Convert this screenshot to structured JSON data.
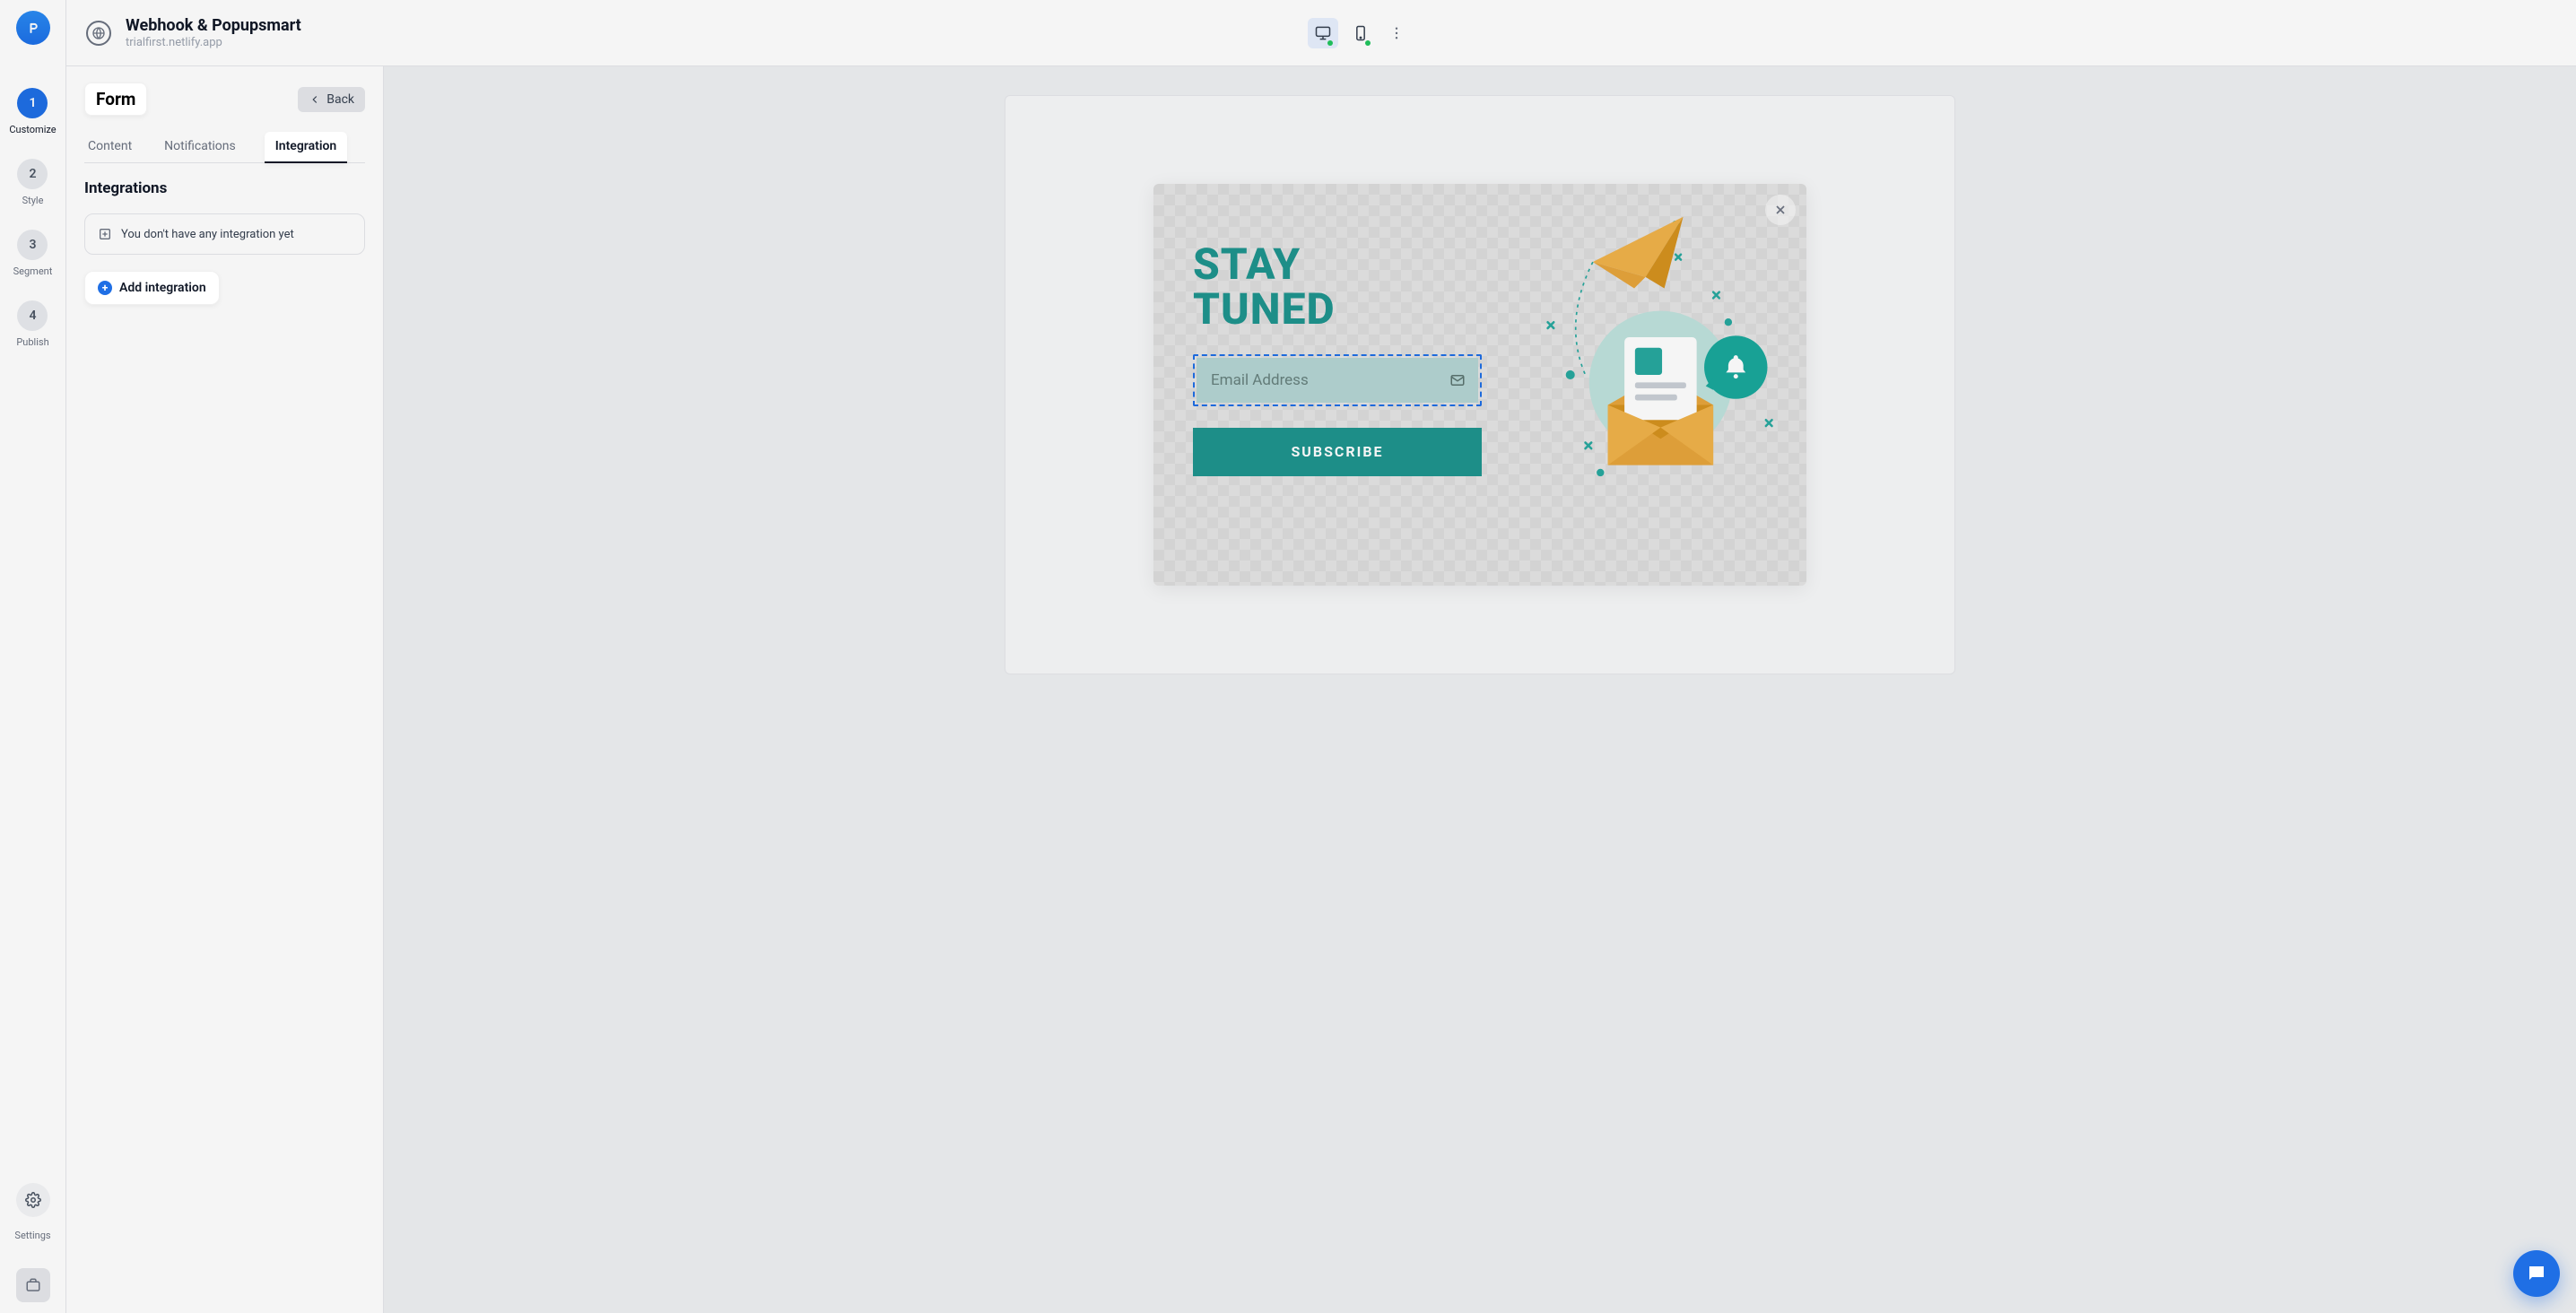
{
  "header": {
    "title": "Webhook & Popupsmart",
    "url": "trialfirst.netlify.app"
  },
  "devices": {
    "desktop_active": true,
    "mobile_active": false
  },
  "rail": {
    "steps": [
      {
        "num": "1",
        "label": "Customize",
        "active": true
      },
      {
        "num": "2",
        "label": "Style",
        "active": false
      },
      {
        "num": "3",
        "label": "Segment",
        "active": false
      },
      {
        "num": "4",
        "label": "Publish",
        "active": false
      }
    ],
    "settings_label": "Settings"
  },
  "panel": {
    "title": "Form",
    "back_label": "Back",
    "tabs": {
      "content": "Content",
      "notifications": "Notifications",
      "integration": "Integration"
    },
    "section_title": "Integrations",
    "empty_message": "You don't have any integration yet",
    "add_label": "Add integration"
  },
  "popup": {
    "title_line1": "STAY",
    "title_line2": "TUNED",
    "email_placeholder": "Email Address",
    "subscribe_label": "SUBSCRIBE"
  }
}
